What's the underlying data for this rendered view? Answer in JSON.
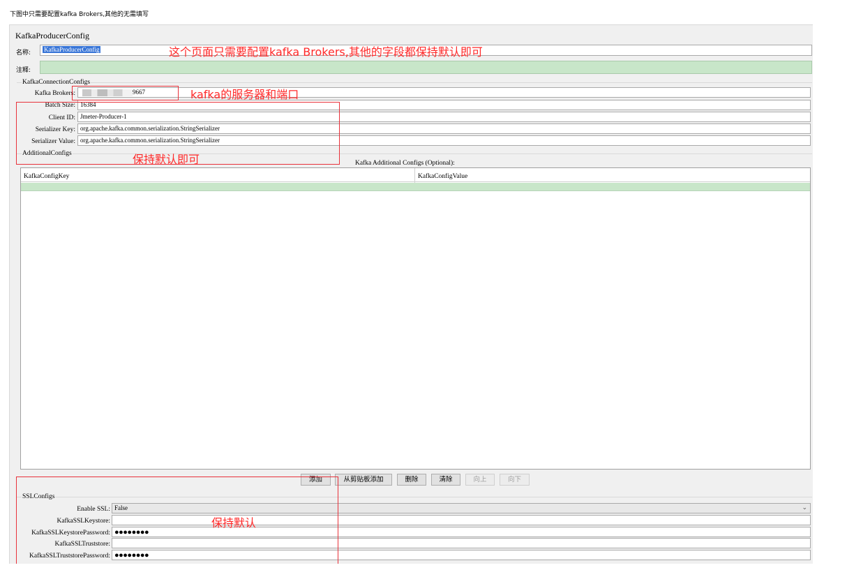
{
  "top_note": "下图中只需要配置kafka Brokers,其他的无需填写",
  "panel_title": "KafkaProducerConfig",
  "name_field": {
    "label": "名称:",
    "value": "KafkaProducerConfig"
  },
  "comment_field": {
    "label": "注释:",
    "value": ""
  },
  "connection": {
    "group_title": "KafkaConnectionConfigs",
    "brokers": {
      "label": "Kafka Brokers:",
      "value_suffix": "9667"
    },
    "batch_size": {
      "label": "Batch Size:",
      "value": "16384"
    },
    "client_id": {
      "label": "Client ID:",
      "value": "Jmeter-Producer-1"
    },
    "serializer_key": {
      "label": "Serializer Key:",
      "value": "org.apache.kafka.common.serialization.StringSerializer"
    },
    "serializer_value": {
      "label": "Serializer Value:",
      "value": "org.apache.kafka.common.serialization.StringSerializer"
    }
  },
  "additional": {
    "group_title": "AdditionalConfigs",
    "table_title": "Kafka Additional Configs (Optional):",
    "columns": [
      "KafkaConfigKey",
      "KafkaConfigValue"
    ]
  },
  "buttons": {
    "add": "添加",
    "add_clipboard": "从剪贴板添加",
    "delete": "删除",
    "clear": "清除",
    "up": "向上",
    "down": "向下"
  },
  "ssl": {
    "group_title": "SSLConfigs",
    "enable": {
      "label": "Enable SSL:",
      "value": "False"
    },
    "keystore": {
      "label": "KafkaSSLKeystore:",
      "value": ""
    },
    "keystore_password": {
      "label": "KafkaSSLKeystorePassword:",
      "value": "●●●●●●●●"
    },
    "truststore": {
      "label": "KafkaSSLTruststore:",
      "value": ""
    },
    "truststore_password": {
      "label": "KafkaSSLTruststorePassword:",
      "value": "●●●●●●●●"
    }
  },
  "annotations": {
    "page_note": "这个页面只需要配置kafka Brokers,其他的字段都保持默认即可",
    "broker_note": "kafka的服务器和端口",
    "default_note": "保持默认即可",
    "ssl_note": "保持默认"
  },
  "colors": {
    "annotation_red": "#ff2a2a",
    "selection_blue": "#3875d7",
    "comment_green": "#c8e6c9"
  }
}
